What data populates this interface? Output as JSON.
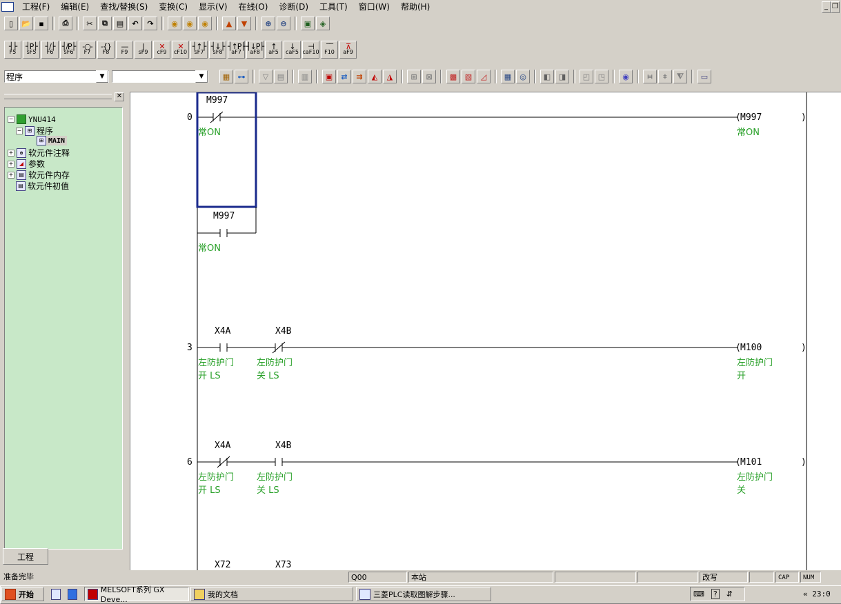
{
  "menu": {
    "items": [
      "工程(F)",
      "编辑(E)",
      "查找/替换(S)",
      "变换(C)",
      "显示(V)",
      "在线(O)",
      "诊断(D)",
      "工具(T)",
      "窗口(W)",
      "帮助(H)"
    ]
  },
  "toolbar_fkeys": [
    {
      "sym": "┤├",
      "key": "F5"
    },
    {
      "sym": "┤P├",
      "key": "sF5"
    },
    {
      "sym": "┤/├",
      "key": "F6"
    },
    {
      "sym": "┤/P├",
      "key": "sF6"
    },
    {
      "sym": "-○-",
      "key": "F7"
    },
    {
      "sym": "-{}",
      "key": "F8"
    },
    {
      "sym": "—",
      "key": "F9"
    },
    {
      "sym": "|",
      "key": "sF9"
    },
    {
      "sym": "✕",
      "key": "cF9"
    },
    {
      "sym": "✕",
      "key": "cF10"
    },
    {
      "sym": "┤↑├",
      "key": "sF7"
    },
    {
      "sym": "┤↓├",
      "key": "sF8"
    },
    {
      "sym": "┤↑P├",
      "key": "aF7"
    },
    {
      "sym": "┤↓P├",
      "key": "aF8"
    },
    {
      "sym": "↑",
      "key": "aF5"
    },
    {
      "sym": "↓",
      "key": "caF5"
    },
    {
      "sym": "⊣",
      "key": "caF10"
    },
    {
      "sym": "‾‾",
      "key": "F10"
    },
    {
      "sym": "⊼",
      "key": "aF9"
    }
  ],
  "combos": {
    "data_type": "程序",
    "program": ""
  },
  "tree": {
    "root": "YNU414",
    "program_group": "程序",
    "main": "MAIN",
    "device_comment": "软元件注释",
    "parameter": "参数",
    "device_memory": "软元件内存",
    "device_init": "软元件初值"
  },
  "pane_tab": "工程",
  "ladder": {
    "rungs": [
      {
        "step": "0",
        "contacts": [
          {
            "dev": "M997",
            "type": "nc",
            "comment": [
              "常ON"
            ]
          }
        ],
        "coil": {
          "dev": "M997",
          "comment": [
            "常ON"
          ]
        }
      },
      {
        "step": "",
        "contacts": [
          {
            "dev": "M997",
            "type": "no",
            "comment": [
              "常ON"
            ]
          }
        ]
      },
      {
        "step": "3",
        "contacts": [
          {
            "dev": "X4A",
            "type": "no",
            "comment": [
              "左防护门",
              "开 LS"
            ]
          },
          {
            "dev": "X4B",
            "type": "nc",
            "comment": [
              "左防护门",
              "关 LS"
            ]
          }
        ],
        "coil": {
          "dev": "M100",
          "comment": [
            "左防护门",
            "开"
          ]
        }
      },
      {
        "step": "6",
        "contacts": [
          {
            "dev": "X4A",
            "type": "nc",
            "comment": [
              "左防护门",
              "开 LS"
            ]
          },
          {
            "dev": "X4B",
            "type": "no",
            "comment": [
              "左防护门",
              "关 LS"
            ]
          }
        ],
        "coil": {
          "dev": "M101",
          "comment": [
            "左防护门",
            "关"
          ]
        }
      },
      {
        "step": "",
        "contacts": [
          {
            "dev": "X72"
          },
          {
            "dev": "X73"
          }
        ]
      }
    ]
  },
  "status": {
    "ready": "准备完毕",
    "cpu": "Q00",
    "station": "本站",
    "mode": "改写",
    "caps": "CAP",
    "num": "NUM"
  },
  "taskbar": {
    "start": "开始",
    "tasks": [
      "MELSOFT系列 GX Deve...",
      "我的文档",
      "三菱PLC读取图解步骤..."
    ],
    "clock": "« 23:0"
  }
}
